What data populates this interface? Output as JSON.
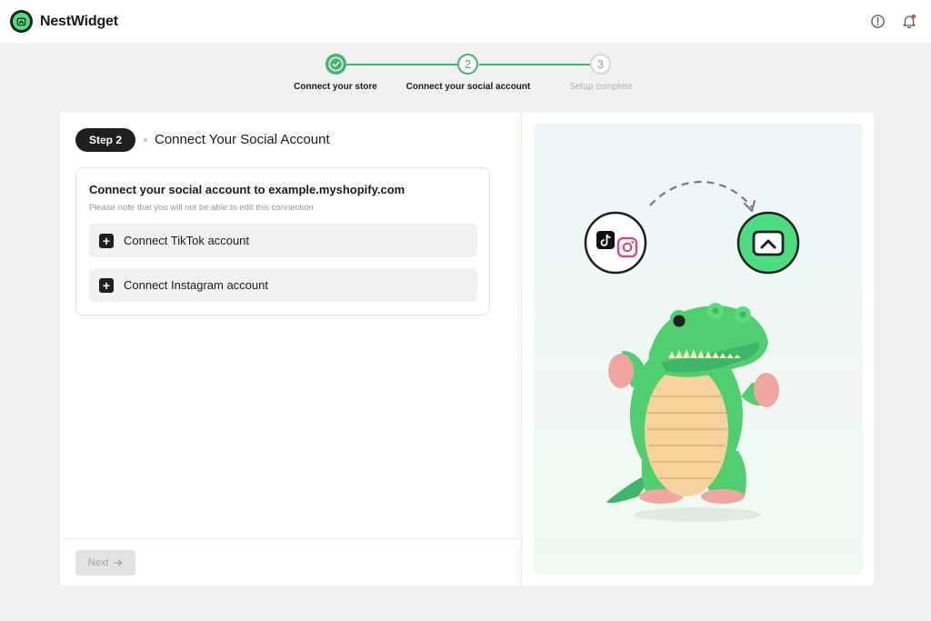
{
  "app": {
    "name": "NestWidget"
  },
  "header": {
    "help_icon": "alert-circle-icon",
    "bell_icon": "bell-icon"
  },
  "stepper": {
    "steps": [
      {
        "number": "1",
        "label": "Connect your store",
        "state": "completed"
      },
      {
        "number": "2",
        "label": "Connect your social account",
        "state": "active"
      },
      {
        "number": "3",
        "label": "Setup complete",
        "state": "pending"
      }
    ]
  },
  "main": {
    "step_badge": "Step 2",
    "title": "Connect Your Social Account",
    "connect_heading": "Connect your social account to example.myshopify.com",
    "connect_note": "Please note that you will not be able to edit this connection",
    "buttons": [
      {
        "label": "Connect TikTok account"
      },
      {
        "label": "Connect Instagram account"
      }
    ],
    "next_label": "Next"
  },
  "colors": {
    "accent": "#3fb76a",
    "accent_light": "#4ade80",
    "dark": "#1f1f1f",
    "muted": "#a3a3a3"
  }
}
